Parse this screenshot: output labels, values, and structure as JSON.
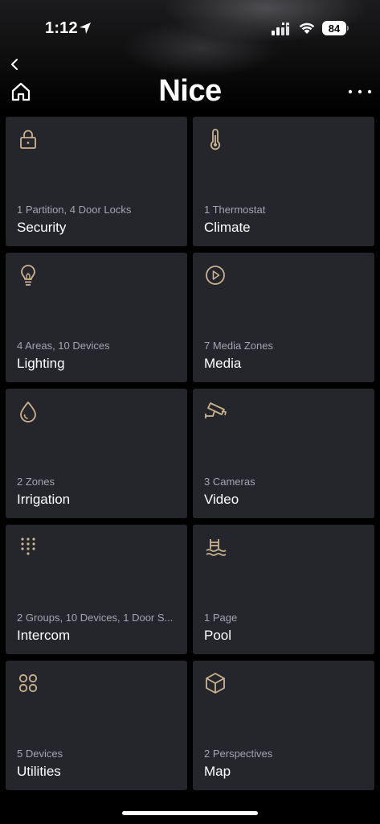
{
  "status_bar": {
    "time": "1:12",
    "battery": "84"
  },
  "header": {
    "title": "Nice"
  },
  "accent_color": "#c9b48e",
  "tiles": [
    {
      "icon": "lock-icon",
      "subtitle": "1 Partition, 4 Door Locks",
      "label": "Security"
    },
    {
      "icon": "thermometer-icon",
      "subtitle": "1 Thermostat",
      "label": "Climate"
    },
    {
      "icon": "lightbulb-icon",
      "subtitle": "4 Areas, 10 Devices",
      "label": "Lighting"
    },
    {
      "icon": "play-icon",
      "subtitle": "7 Media Zones",
      "label": "Media"
    },
    {
      "icon": "water-drop-icon",
      "subtitle": "2 Zones",
      "label": "Irrigation"
    },
    {
      "icon": "camera-icon",
      "subtitle": "3 Cameras",
      "label": "Video"
    },
    {
      "icon": "keypad-icon",
      "subtitle": "2 Groups, 10 Devices, 1 Door S...",
      "label": "Intercom"
    },
    {
      "icon": "pool-icon",
      "subtitle": "1 Page",
      "label": "Pool"
    },
    {
      "icon": "grid-circles-icon",
      "subtitle": "5 Devices",
      "label": "Utilities"
    },
    {
      "icon": "cube-icon",
      "subtitle": "2 Perspectives",
      "label": "Map"
    }
  ]
}
